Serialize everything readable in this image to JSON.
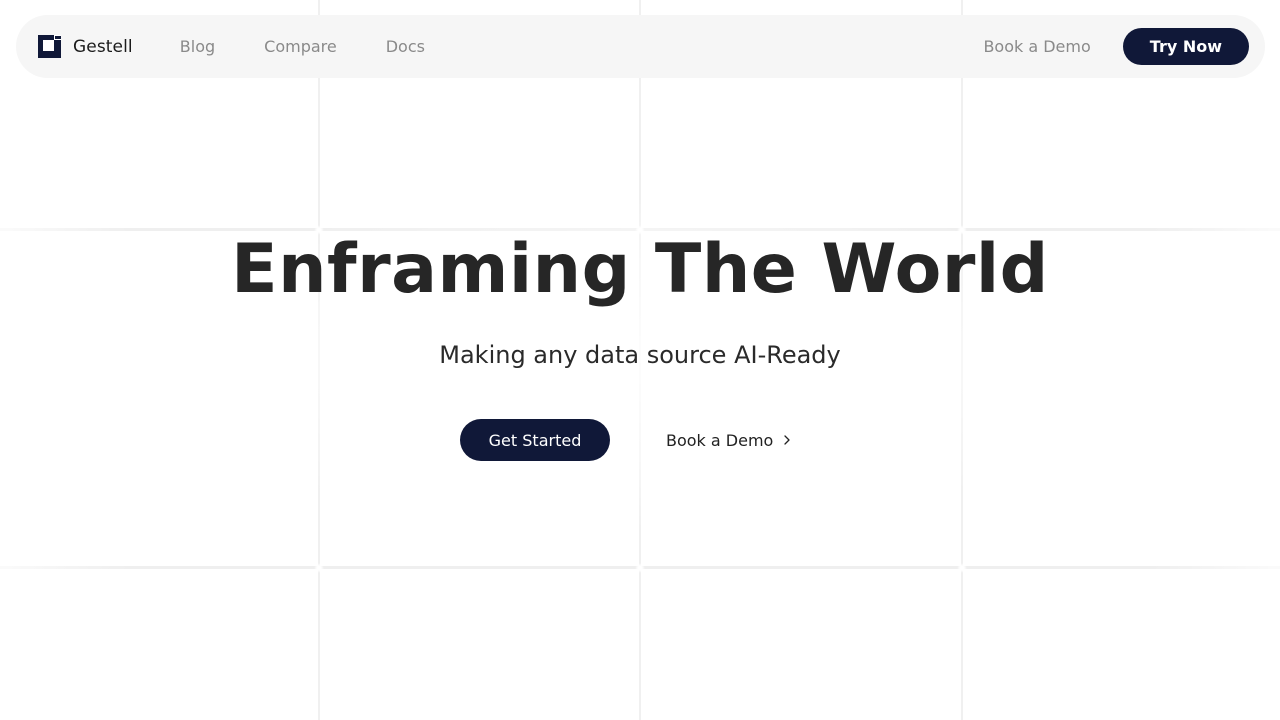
{
  "nav": {
    "brand_name": "Gestell",
    "logo_icon": "gestell-logo-icon",
    "links": [
      {
        "label": "Blog"
      },
      {
        "label": "Compare"
      },
      {
        "label": "Docs"
      }
    ],
    "book_demo_label": "Book a Demo",
    "try_now_label": "Try Now"
  },
  "hero": {
    "title": "Enframing The World",
    "subtitle": "Making any data source AI-Ready",
    "primary_cta_label": "Get Started",
    "secondary_cta_label": "Book a Demo",
    "secondary_cta_icon": "chevron-right-icon"
  },
  "colors": {
    "brand_navy": "#101838",
    "text_dark": "#262626",
    "nav_muted": "#8a8a8a",
    "nav_background": "#f6f6f6",
    "grid_line": "#f0f0f0"
  }
}
